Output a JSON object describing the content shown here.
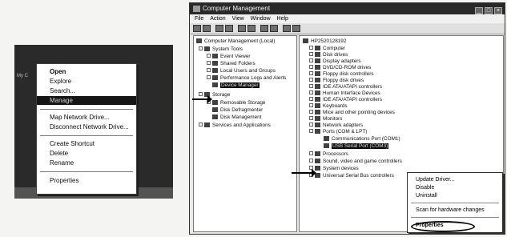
{
  "context_menu": {
    "items": [
      {
        "label": "Open",
        "bold": true
      },
      {
        "label": "Explore"
      },
      {
        "label": "Search..."
      },
      {
        "label": "Manage",
        "selected": true
      },
      {
        "label": "Map Network Drive..."
      },
      {
        "label": "Disconnect Network Drive..."
      },
      {
        "label": "Create Shortcut"
      },
      {
        "label": "Delete"
      },
      {
        "label": "Rename"
      },
      {
        "label": "Properties"
      }
    ]
  },
  "window": {
    "title": "Computer Management",
    "menu": [
      "File",
      "Action",
      "View",
      "Window",
      "Help"
    ],
    "left_tree": [
      "Computer Management (Local)",
      "System Tools",
      "Event Viewer",
      "Shared Folders",
      "Local Users and Groups",
      "Performance Logs and Alerts",
      "Device Manager",
      "Storage",
      "Removable Storage",
      "Disk Defragmenter",
      "Disk Management",
      "Services and Applications"
    ],
    "right_tree": [
      "HP2520128192",
      "Computer",
      "Disk drives",
      "Display adapters",
      "DVD/CD-ROM drives",
      "Floppy disk controllers",
      "Floppy disk drives",
      "IDE ATA/ATAPI controllers",
      "Human Interface Devices",
      "IDE ATA/ATAPI controllers",
      "Keyboards",
      "Mice and other pointing devices",
      "Monitors",
      "Network adapters",
      "Ports (COM & LPT)",
      "Communications Port (COM1)",
      "USB Serial Port (COM3)",
      "Processors",
      "Sound, video and game controllers",
      "System devices",
      "Universal Serial Bus controllers"
    ]
  },
  "device_menu": {
    "items": [
      "Update Driver...",
      "Disable",
      "Uninstall",
      "Scan for hardware changes",
      "Properties"
    ]
  }
}
